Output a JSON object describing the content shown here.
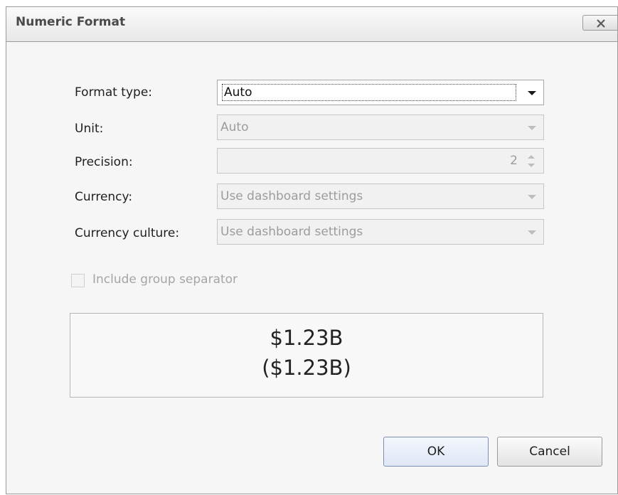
{
  "dialog": {
    "title": "Numeric Format",
    "close_icon": "close-icon"
  },
  "form": {
    "format_type": {
      "label": "Format type:",
      "value": "Auto"
    },
    "unit": {
      "label": "Unit:",
      "value": "Auto"
    },
    "precision": {
      "label": "Precision:",
      "value": "2"
    },
    "currency": {
      "label": "Currency:",
      "value": "Use dashboard settings"
    },
    "currency_culture": {
      "label": "Currency culture:",
      "value": "Use dashboard settings"
    },
    "group_separator": {
      "label": "Include group separator",
      "checked": false
    }
  },
  "preview": {
    "positive": "$1.23B",
    "negative": "($1.23B)"
  },
  "buttons": {
    "ok": "OK",
    "cancel": "Cancel"
  }
}
